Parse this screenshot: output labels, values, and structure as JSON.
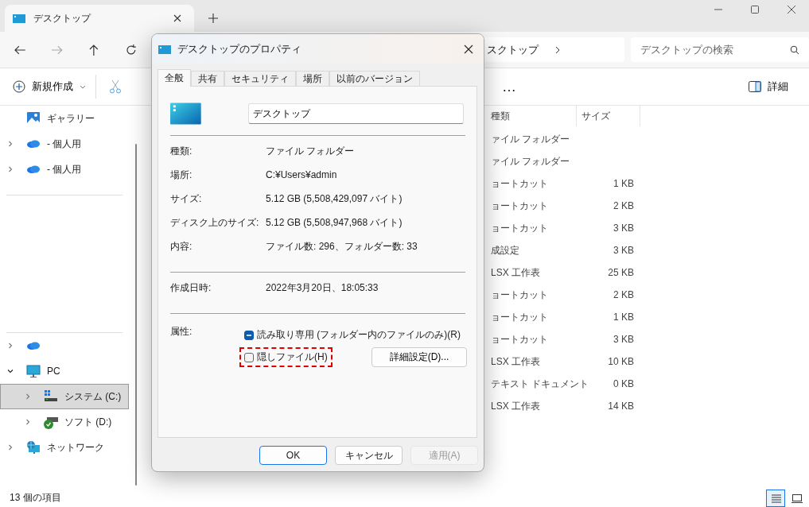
{
  "window": {
    "tab_title": "デスクトップ"
  },
  "address": {
    "crumb": "スクトップ"
  },
  "search": {
    "placeholder": "デスクトップの検索"
  },
  "toolbar": {
    "new": "新規作成",
    "more": "…",
    "details": "詳細"
  },
  "sidebar": {
    "groups": [
      [
        {
          "kind": "gallery",
          "label": "ギャラリー",
          "expandable": false,
          "selected": false
        },
        {
          "kind": "cloud",
          "label": "- 個人用",
          "expandable": true,
          "expanded": false,
          "selected": false
        },
        {
          "kind": "cloud",
          "label": "- 個人用",
          "expandable": true,
          "expanded": false,
          "selected": false
        }
      ],
      [
        {
          "kind": "cloud",
          "expandable": true,
          "expanded": false,
          "selected": false
        },
        {
          "kind": "pc",
          "label": "PC",
          "expandable": true,
          "expanded": true,
          "selected": false,
          "children": [
            {
              "kind": "drive-c",
              "label": "システム (C:)",
              "expandable": true,
              "expanded": false,
              "selected": true
            },
            {
              "kind": "drive-d",
              "label": "ソフト (D:)",
              "expandable": true,
              "expanded": false,
              "selected": false
            }
          ]
        },
        {
          "kind": "network",
          "label": "ネットワーク",
          "expandable": true,
          "expanded": false,
          "selected": false
        }
      ]
    ]
  },
  "columns": [
    {
      "label": "種類"
    },
    {
      "label": "サイズ"
    }
  ],
  "rows": [
    {
      "type": "ァイル フォルダー"
    },
    {
      "type": "ァイル フォルダー"
    },
    {
      "type": "ョートカット",
      "size": "1 KB"
    },
    {
      "type": "ョートカット",
      "size": "2 KB"
    },
    {
      "type": "ョートカット",
      "size": "3 KB"
    },
    {
      "type": "成設定",
      "size": "3 KB"
    },
    {
      "type": "LSX 工作表",
      "size": "25 KB"
    },
    {
      "type": "ョートカット",
      "size": "2 KB"
    },
    {
      "type": "ョートカット",
      "size": "1 KB"
    },
    {
      "type": "ョートカット",
      "size": "3 KB"
    },
    {
      "type": "LSX 工作表",
      "size": "10 KB"
    },
    {
      "type": "テキスト ドキュメント",
      "size": "0 KB"
    },
    {
      "type": "LSX 工作表",
      "size": "14 KB"
    }
  ],
  "status_bar": {
    "count": "13 個の項目"
  },
  "view_buttons": [
    {
      "kind": "details",
      "selected": true
    },
    {
      "kind": "tiles",
      "selected": false
    }
  ],
  "dialog": {
    "title": "デスクトップのプロパティ",
    "tabs": [
      {
        "label": "全般",
        "selected": true
      },
      {
        "label": "共有",
        "selected": false
      },
      {
        "label": "セキュリティ",
        "selected": false
      },
      {
        "label": "場所",
        "selected": false
      },
      {
        "label": "以前のバージョン",
        "selected": false
      }
    ],
    "name_field": {
      "value": "デスクトップ"
    },
    "info_groups": [
      [
        {
          "label": "種類:",
          "value": "ファイル フォルダー"
        },
        {
          "label": "場所:",
          "value": "C:¥Users¥admin"
        },
        {
          "label": "サイズ:",
          "value": "5.12 GB (5,508,429,097 バイト)"
        },
        {
          "label": "ディスク上のサイズ:",
          "value": "5.12 GB (5,508,947,968 バイト)"
        },
        {
          "label": "内容:",
          "value": "ファイル数: 296、フォルダー数: 33"
        }
      ],
      [
        {
          "label": "作成日時:",
          "value": "2022年3月20日、18:05:33"
        }
      ]
    ],
    "attributes_label": "属性:",
    "attributes": [
      {
        "label": "読み取り専用 (フォルダー内のファイルのみ)(R)",
        "checked": true,
        "indeterminate": true,
        "highlighted": false
      },
      {
        "label": "隠しファイル(H)",
        "checked": false,
        "indeterminate": false,
        "highlighted": true
      }
    ],
    "advanced_button": "詳細設定(D)...",
    "buttons": [
      {
        "label": "OK",
        "default": true,
        "disabled": false
      },
      {
        "label": "キャンセル",
        "default": false,
        "disabled": false
      },
      {
        "label": "適用(A)",
        "default": false,
        "disabled": true
      }
    ]
  }
}
